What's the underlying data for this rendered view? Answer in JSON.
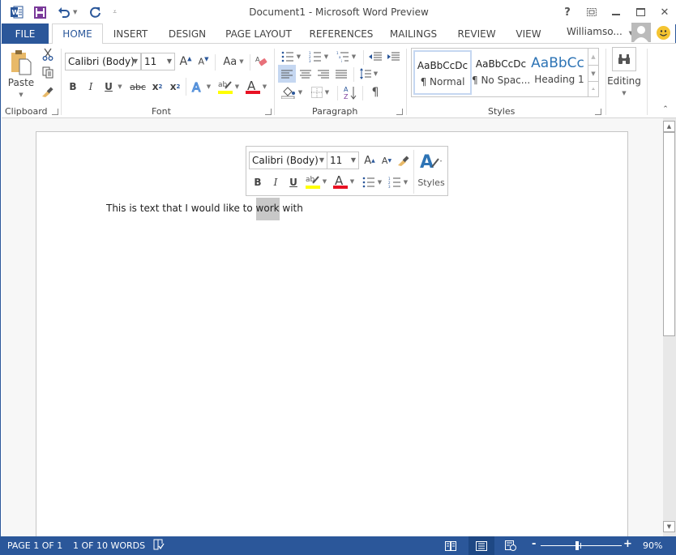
{
  "window": {
    "title": "Document1 - Microsoft Word Preview",
    "controls": {
      "help": "?",
      "restore_ribbon": "ribbon-display-options",
      "minimize": "minimize",
      "maximize": "maximize",
      "close": "close"
    }
  },
  "quick_access": {
    "app_icon": "word-icon",
    "save": "save-icon",
    "undo": "undo-icon",
    "redo": "redo-icon",
    "customize": "customize-icon"
  },
  "tabs": [
    {
      "label": "FILE"
    },
    {
      "label": "HOME",
      "active": true
    },
    {
      "label": "INSERT"
    },
    {
      "label": "DESIGN"
    },
    {
      "label": "PAGE LAYOUT"
    },
    {
      "label": "REFERENCES"
    },
    {
      "label": "MAILINGS"
    },
    {
      "label": "REVIEW"
    },
    {
      "label": "VIEW"
    }
  ],
  "user": {
    "name": "Williamso...",
    "emoji": "smiley"
  },
  "ribbon": {
    "clipboard": {
      "label": "Clipboard",
      "paste": "Paste"
    },
    "font": {
      "label": "Font",
      "font_name": "Calibri (Body)",
      "font_size": "11",
      "change_case": "Aa",
      "bold": "B",
      "italic": "I",
      "underline": "U",
      "strikethrough": "abc",
      "subscript": "x",
      "superscript": "x",
      "highlight_color": "#ffff00",
      "font_color": "#e81123"
    },
    "paragraph": {
      "label": "Paragraph"
    },
    "styles": {
      "label": "Styles",
      "items": [
        {
          "preview": "AaBbCcDc",
          "name": "¶ Normal",
          "selected": true
        },
        {
          "preview": "AaBbCcDc",
          "name": "¶ No Spac..."
        },
        {
          "preview": "AaBbCc",
          "name": "Heading 1"
        }
      ]
    },
    "editing": {
      "label": "Editing"
    }
  },
  "mini_toolbar": {
    "font_name": "Calibri (Body)",
    "font_size": "11",
    "bold": "B",
    "italic": "I",
    "underline": "U",
    "styles": "Styles"
  },
  "document": {
    "text_before": "This is text that I would like to ",
    "selected": "work",
    "text_after": " with"
  },
  "statusbar": {
    "page": "PAGE 1 OF 1",
    "words": "1 OF 10 WORDS",
    "zoom_percent": "90%",
    "zoom_slider_fraction": 0.45,
    "zoom_minus": "-",
    "zoom_plus": "+"
  },
  "colors": {
    "accent": "#2b579a",
    "selection": "#c8c8c8"
  }
}
